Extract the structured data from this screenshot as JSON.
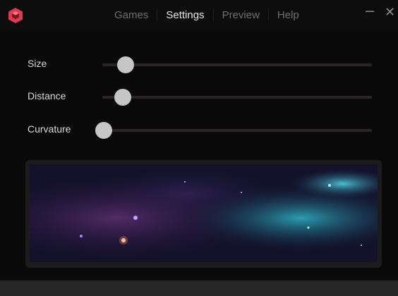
{
  "app": {
    "logo_icon": "cube-logo-icon",
    "accent": "#e03b4f"
  },
  "tabs": [
    {
      "label": "Games",
      "active": false
    },
    {
      "label": "Settings",
      "active": true
    },
    {
      "label": "Preview",
      "active": false
    },
    {
      "label": "Help",
      "active": false
    }
  ],
  "window_controls": {
    "minimize": "–",
    "close": "✕"
  },
  "settings": {
    "sliders": [
      {
        "label": "Size",
        "value": 0.08
      },
      {
        "label": "Distance",
        "value": 0.07
      },
      {
        "label": "Curvature",
        "value": 0.0
      }
    ]
  },
  "preview": {
    "image": "nebula-starfield-preview"
  }
}
